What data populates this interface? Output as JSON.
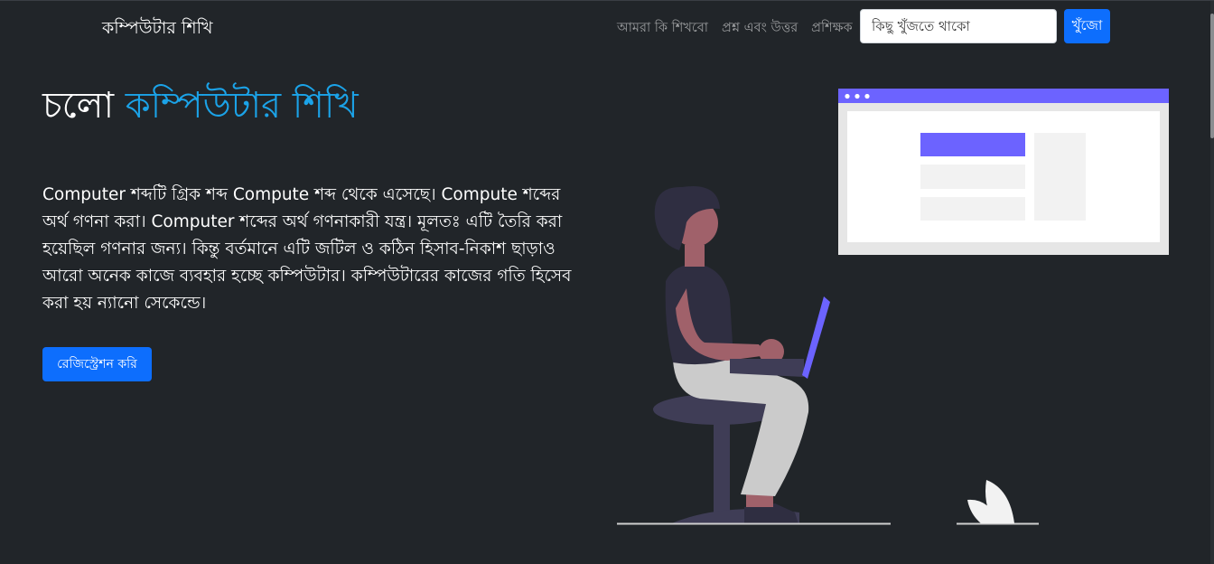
{
  "navbar": {
    "brand": "কম্পিউটার শিখি",
    "links": [
      {
        "label": "আমরা কি শিখবো"
      },
      {
        "label": "প্রশ্ন এবং উত্তর"
      },
      {
        "label": "প্রশিক্ষক"
      }
    ],
    "search": {
      "placeholder": "কিছু খুঁজতে থাকো",
      "value": "",
      "button_label": "খুঁজো"
    }
  },
  "hero": {
    "title_prefix": "চলো",
    "title_accent": "কম্পিউটার শিখি",
    "description": "Computer শব্দটি গ্রিক শব্দ Compute শব্দ থেকে এসেছে। Compute শব্দের অর্থ গণনা করা। Computer শব্দের অর্থ গণনাকারী যন্ত্র। মূলতঃ এটি তৈরি করা হয়েছিল গণনার জন্য। কিন্তু বর্তমানে এটি জটিল ও কঠিন হিসাব-নিকাশ ছাড়াও আরো অনেক কাজে ব্যবহার হচ্ছে কম্পিউটার। কম্পিউটারের কাজের গতি হিসেব করা হয় ন্যানো সেকেন্ডে।",
    "register_label": "রেজিস্ট্রেশন করি"
  },
  "colors": {
    "background": "#212529",
    "primary": "#0d6efd",
    "accent_text": "#1ba3e8",
    "illustration_purple": "#6c63ff"
  }
}
